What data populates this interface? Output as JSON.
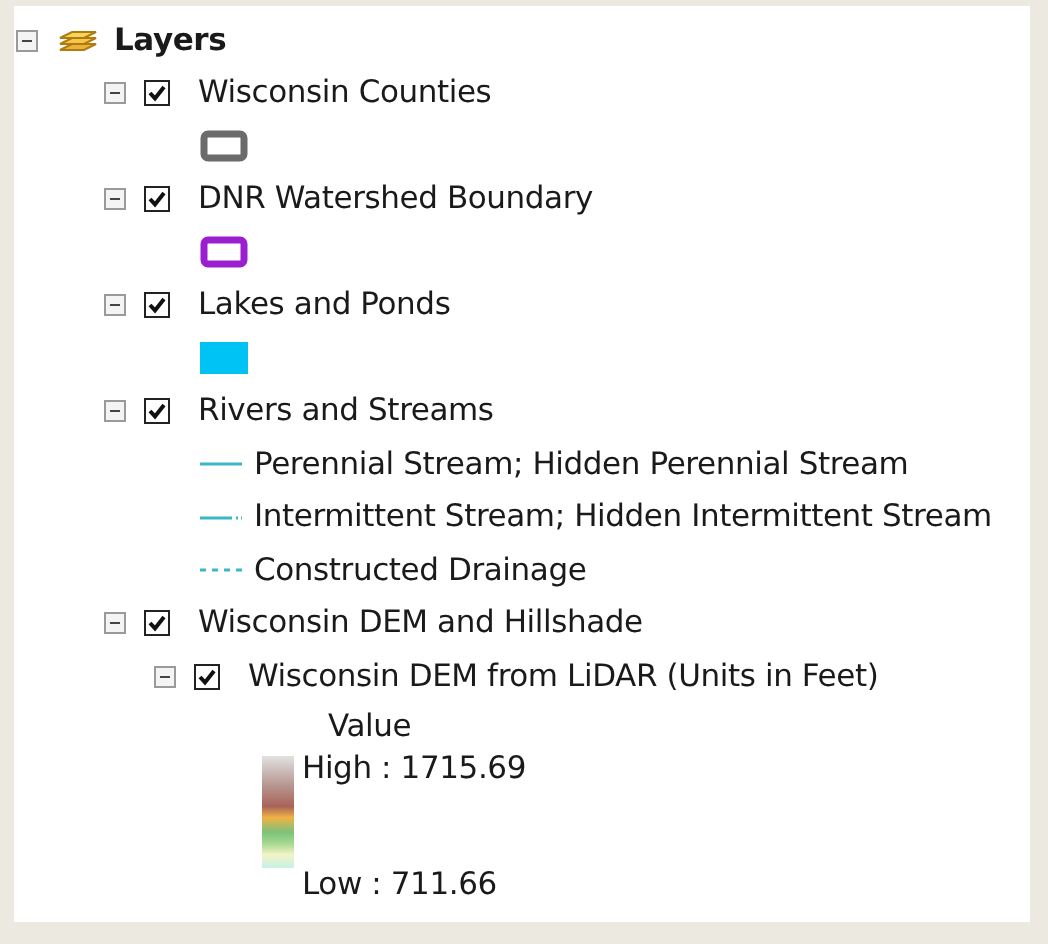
{
  "toc": {
    "label": "Layers",
    "expanded": true,
    "layers": [
      {
        "name": "Wisconsin Counties",
        "expanded": true,
        "checked": true,
        "legend": [
          {
            "kind": "outline",
            "color": "#6b6b6b"
          }
        ]
      },
      {
        "name": "DNR Watershed Boundary",
        "expanded": true,
        "checked": true,
        "legend": [
          {
            "kind": "outline",
            "color": "#9b1fd1"
          }
        ]
      },
      {
        "name": "Lakes and Ponds",
        "expanded": true,
        "checked": true,
        "legend": [
          {
            "kind": "fill",
            "color": "#00c3f5"
          }
        ]
      },
      {
        "name": "Rivers and Streams",
        "expanded": true,
        "checked": true,
        "legend": [
          {
            "kind": "solid-line",
            "color": "#3bb8c8",
            "label": "Perennial Stream; Hidden Perennial Stream"
          },
          {
            "kind": "dash-dot-line",
            "color": "#3bb8c8",
            "label": "Intermittent Stream; Hidden Intermittent Stream"
          },
          {
            "kind": "dashed-line",
            "color": "#3bb8c8",
            "label": "Constructed Drainage"
          }
        ]
      },
      {
        "name": "Wisconsin DEM and Hillshade",
        "expanded": true,
        "checked": true,
        "children": [
          {
            "name": "Wisconsin DEM from LiDAR (Units in Feet)",
            "expanded": true,
            "checked": true,
            "legend": [
              {
                "kind": "ramp",
                "title": "Value",
                "high": "High : 1715.69",
                "low": "Low : 711.66"
              }
            ]
          }
        ]
      }
    ]
  }
}
